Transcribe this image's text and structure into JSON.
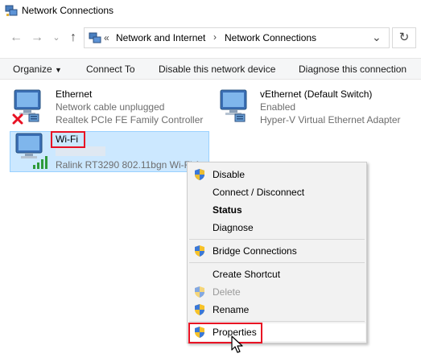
{
  "window": {
    "title": "Network Connections"
  },
  "address": {
    "overflow": "«",
    "crumbs": [
      "Network and Internet",
      "Network Connections"
    ],
    "separator": "›"
  },
  "toolbar": {
    "organize": "Organize",
    "connect_to": "Connect To",
    "disable": "Disable this network device",
    "diagnose": "Diagnose this connection"
  },
  "items": {
    "ethernet": {
      "name": "Ethernet",
      "status": "Network cable unplugged",
      "device": "Realtek PCIe FE Family Controller"
    },
    "vethernet": {
      "name": "vEthernet (Default Switch)",
      "status": "Enabled",
      "device": "Hyper-V Virtual Ethernet Adapter"
    },
    "wifi": {
      "name": "Wi-Fi",
      "device": "Ralink RT3290 802.11bgn Wi-Fi A..."
    }
  },
  "context_menu": {
    "disable": "Disable",
    "connect": "Connect / Disconnect",
    "status": "Status",
    "diagnose": "Diagnose",
    "bridge": "Bridge Connections",
    "shortcut": "Create Shortcut",
    "delete": "Delete",
    "rename": "Rename",
    "properties": "Properties"
  },
  "colors": {
    "highlight": "#e81123",
    "selection": "#cce8ff",
    "shield_blue": "#2a5caa",
    "shield_yellow": "#f6c22a"
  }
}
